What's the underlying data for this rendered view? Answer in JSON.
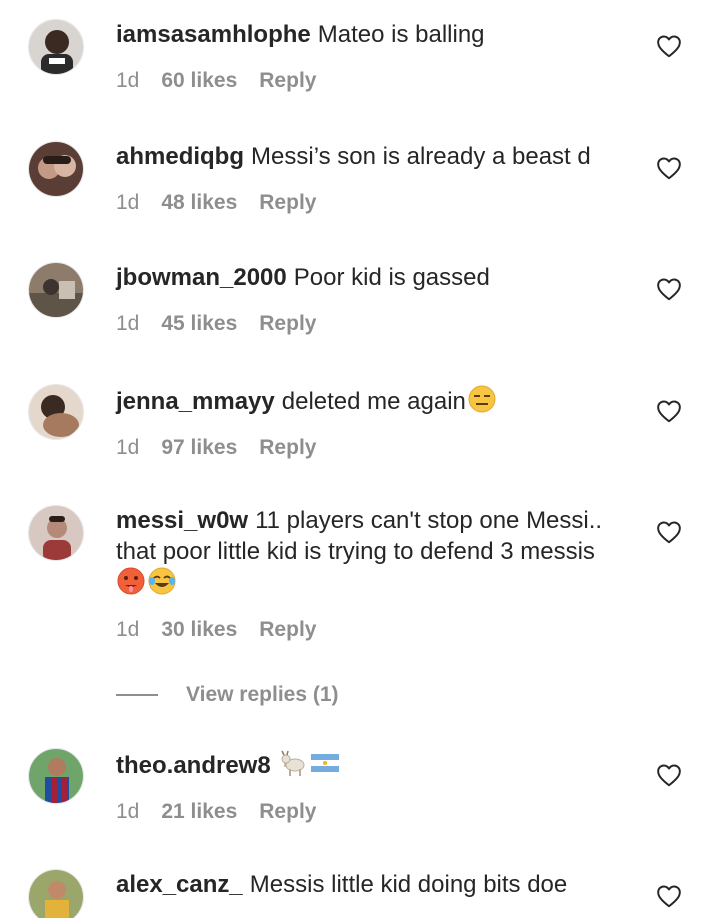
{
  "comments": [
    {
      "username": "iamsasamhlophe",
      "text": "Mateo is balling",
      "age": "1d",
      "likes": "60 likes",
      "reply": "Reply",
      "avatar_color": "#3a3632"
    },
    {
      "username": "ahmediqbg",
      "text": "Messi’s son is already a beast d",
      "age": "1d",
      "likes": "48 likes",
      "reply": "Reply",
      "avatar_color": "#6b5045"
    },
    {
      "username": "jbowman_2000",
      "text": "Poor kid is gassed",
      "age": "1d",
      "likes": "45 likes",
      "reply": "Reply",
      "avatar_color": "#7b6a5c"
    },
    {
      "username": "jenna_mmayy",
      "text": "deleted me again",
      "age": "1d",
      "likes": "97 likes",
      "reply": "Reply",
      "avatar_color": "#8a6a55"
    },
    {
      "username": "messi_w0w",
      "text": "11 players can't stop one Messi.. that poor little kid is trying to defend 3 messis",
      "age": "1d",
      "likes": "30 likes",
      "reply": "Reply",
      "avatar_color": "#9a7b72"
    },
    {
      "username": "theo.andrew8",
      "text": "",
      "age": "1d",
      "likes": "21 likes",
      "reply": "Reply",
      "avatar_color": "#2f5fa8"
    },
    {
      "username": "alex_canz_",
      "text": "Messis little kid doing bits doe",
      "age": "",
      "likes": "",
      "reply": "",
      "avatar_color": "#6c7a3e"
    }
  ],
  "view_replies": "View replies (1)",
  "colors": {
    "text": "#262626",
    "muted": "#8e8e8e",
    "background": "#ffffff"
  },
  "icons": {
    "like": "heart-outline-icon"
  }
}
